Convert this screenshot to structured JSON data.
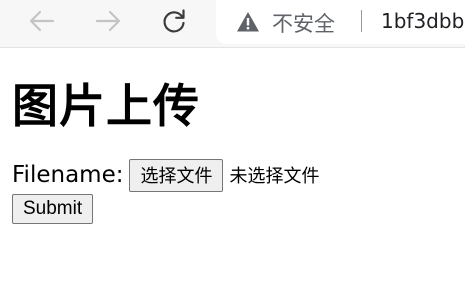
{
  "browser": {
    "security_label": "不安全",
    "url": "1bf3dbb",
    "icons": {
      "back": "arrow-left-icon",
      "forward": "arrow-right-icon",
      "reload": "reload-icon",
      "warning": "warning-triangle-icon"
    }
  },
  "page": {
    "heading": "图片上传",
    "form": {
      "filename_label": "Filename:",
      "choose_file_label": "选择文件",
      "no_file_text": "未选择文件",
      "submit_label": "Submit"
    }
  }
}
